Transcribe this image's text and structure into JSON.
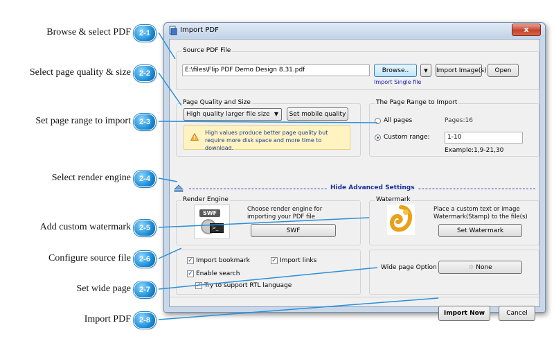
{
  "callouts": [
    {
      "label": "Browse & select PDF",
      "num": "2-1"
    },
    {
      "label": "Select page quality & size",
      "num": "2-2"
    },
    {
      "label": "Set page range to import",
      "num": "2-3"
    },
    {
      "label": "Select render engine",
      "num": "2-4"
    },
    {
      "label": "Add custom watermark",
      "num": "2-5"
    },
    {
      "label": "Configure source file",
      "num": "2-6"
    },
    {
      "label": "Set wide page",
      "num": "2-7"
    },
    {
      "label": "Import PDF",
      "num": "2-8"
    }
  ],
  "window": {
    "title": "Import PDF",
    "close": "x",
    "source": {
      "title": "Source PDF File",
      "path": "E:\\files\\Flip PDF Demo Design 8.31.pdf",
      "browse": "Browse..",
      "dropdown": "▼",
      "import_image": "Import Image(s)",
      "open": "Open",
      "import_single": "Import Single file"
    },
    "quality": {
      "title": "Page Quality and Size",
      "selected": "High quality larger file size",
      "mobile_btn": "Set mobile quality",
      "warning": "High values produce better page quality but require more disk space and more time to download."
    },
    "range": {
      "title": "The Page Range to Import",
      "all_pages": "All pages",
      "pages_count": "Pages:16",
      "custom_range": "Custom range:",
      "custom_value": "1-10",
      "example": "Example:1,9-21,30"
    },
    "advanced_label": "Hide Advanced Settings",
    "render": {
      "title": "Render Engine",
      "desc": "Choose render engine for importing your PDF file",
      "swf_icon_text": "SWF",
      "swf_btn": "SWF"
    },
    "watermark": {
      "title": "Watermark",
      "desc": "Place a custom text or image Watermark(Stamp) to the file(s)",
      "btn": "Set Watermark"
    },
    "options": {
      "import_bookmark": "Import bookmark",
      "import_links": "Import links",
      "enable_search": "Enable search",
      "rtl": "Try to support RTL language"
    },
    "wide": {
      "label": "Wide page Option",
      "btn": "None"
    },
    "import_now": "Import Now",
    "cancel": "Cancel"
  },
  "colors": {
    "badge": "#1e8fd9",
    "title_bar": "#c8d8ea",
    "advanced": "#1a2ea0",
    "link": "#1a1aa6"
  }
}
